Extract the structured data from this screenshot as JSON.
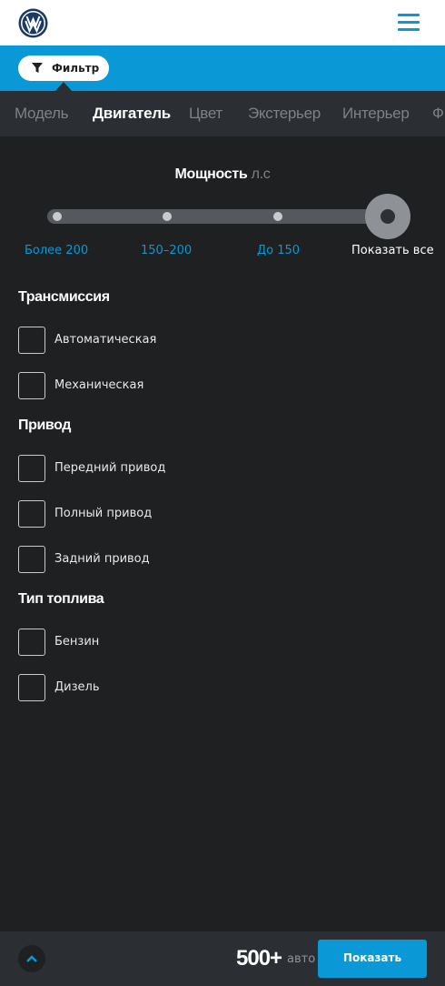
{
  "header": {
    "logo_icon": "volkswagen-logo",
    "menu_icon": "hamburger-menu-icon",
    "accent_color": "#0a98d6"
  },
  "filterbar": {
    "filter_label": "Фильтр",
    "filter_icon": "funnel-icon",
    "stats_icon": "bar-chart-icon",
    "location_icon": "map-pin-icon"
  },
  "tabs": [
    "Модель",
    "Двигатель",
    "Цвет",
    "Экстерьер",
    "Интерьер",
    "Ф"
  ],
  "active_tab": "Двигатель",
  "power": {
    "title": "Мощность",
    "unit": "л.с",
    "ranges": [
      "Более 200",
      "150–200",
      "До 150",
      "Показать все"
    ],
    "selected": "Показать все"
  },
  "groups": {
    "transmission": {
      "title": "Трансмиссия",
      "options": [
        "Автоматическая",
        "Механическая"
      ]
    },
    "drive": {
      "title": "Привод",
      "options": [
        "Передний привод",
        "Полный привод",
        "Задний привод"
      ]
    },
    "fuel": {
      "title": "Тип топлива",
      "options": [
        "Бензин",
        "Дизель"
      ]
    }
  },
  "footer": {
    "count": "500+",
    "count_unit": "авто",
    "show_label": "Показать",
    "scroll_up_icon": "chevron-up-icon"
  }
}
